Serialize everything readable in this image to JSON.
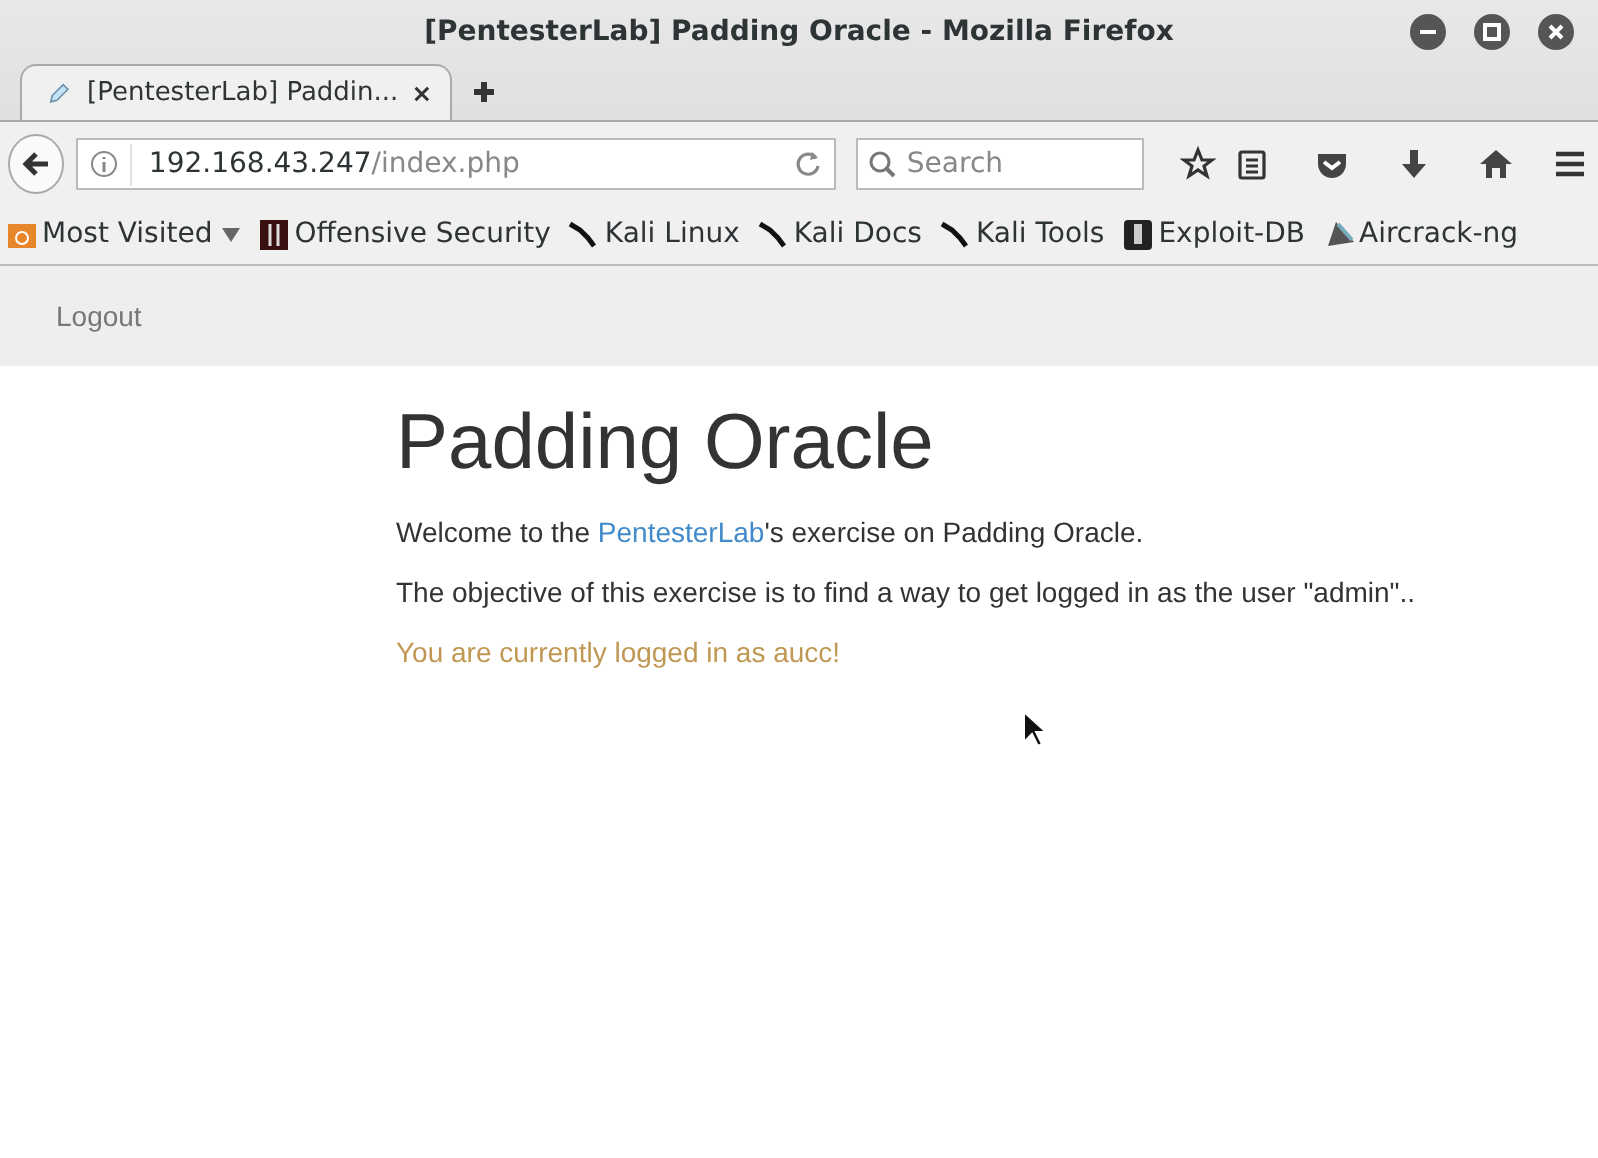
{
  "window": {
    "title": "[PentesterLab] Padding Oracle - Mozilla Firefox"
  },
  "tabs": [
    {
      "label": "[PentesterLab] Paddin...",
      "selected": true
    }
  ],
  "address_bar": {
    "host": "192.168.43.247",
    "path": "/index.php"
  },
  "search": {
    "placeholder": "Search"
  },
  "bookmarks": [
    {
      "label": "Most Visited",
      "kind": "folder"
    },
    {
      "label": "Offensive Security",
      "kind": "offsec"
    },
    {
      "label": "Kali Linux",
      "kind": "kali"
    },
    {
      "label": "Kali Docs",
      "kind": "kali"
    },
    {
      "label": "Kali Tools",
      "kind": "kali"
    },
    {
      "label": "Exploit-DB",
      "kind": "exploitdb"
    },
    {
      "label": "Aircrack-ng",
      "kind": "aircrack"
    }
  ],
  "site_nav": {
    "links": [
      "Logout"
    ]
  },
  "content": {
    "heading": "Padding Oracle",
    "welcome": {
      "before": "Welcome to the ",
      "link": "PentesterLab",
      "after": "'s exercise on Padding Oracle."
    },
    "objective": "The objective of this exercise is to find a way to get logged in as the user \"admin\"..",
    "status": "You are currently logged in as aucc!"
  }
}
